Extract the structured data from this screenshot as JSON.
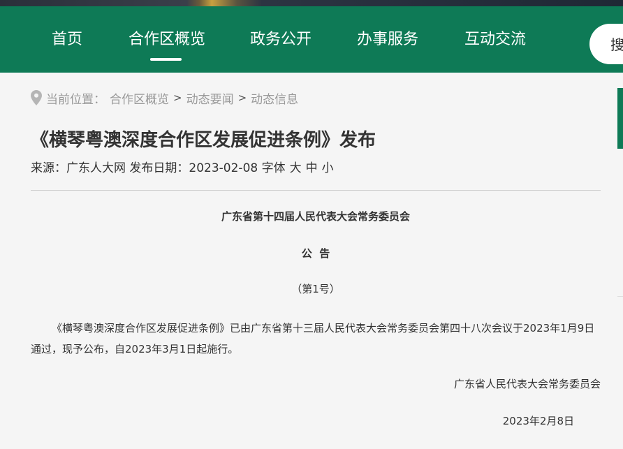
{
  "nav": {
    "items": [
      {
        "label": "首页"
      },
      {
        "label": "合作区概览"
      },
      {
        "label": "政务公开"
      },
      {
        "label": "办事服务"
      },
      {
        "label": "互动交流"
      }
    ],
    "active_index": 1,
    "search_label": "搜",
    "accent_color": "#0e7a56"
  },
  "breadcrumb": {
    "prefix": "当前位置：",
    "items": [
      "合作区概览",
      "动态要闻",
      "动态信息"
    ],
    "separator": ">"
  },
  "article": {
    "title": "《横琴粤澳深度合作区发展促进条例》发布",
    "source_label": "来源：",
    "source": "广东人大网",
    "date_label": "发布日期：",
    "date": "2023-02-08",
    "font_size_label": "字体",
    "font_sizes": [
      "大",
      "中",
      "小"
    ],
    "issuer": "广东省第十四届人民代表大会常务委员会",
    "notice": "公  告",
    "number": "（第1号）",
    "body": "《横琴粤澳深度合作区发展促进条例》已由广东省第十三届人民代表大会常务委员会第四十八次会议于2023年1月9日通过，现予公布，自2023年3月1日起施行。",
    "signature": "广东省人民代表大会常务委员会",
    "signature_date": "2023年2月8日"
  }
}
